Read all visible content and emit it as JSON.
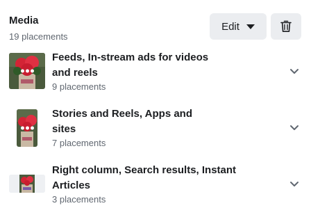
{
  "header": {
    "title": "Media",
    "subtitle": "19 placements",
    "edit_label": "Edit"
  },
  "rows": [
    {
      "title_line1": "Feeds, In-stream ads for videos",
      "title_line2": "and reels",
      "count": "9 placements",
      "thumb_shape": "square"
    },
    {
      "title_line1": "Stories and Reels, Apps and",
      "title_line2": "sites",
      "count": "7 placements",
      "thumb_shape": "vertical"
    },
    {
      "title_line1": "Right column, Search results, Instant",
      "title_line2": "Articles",
      "count": "3 placements",
      "thumb_shape": "horizontal"
    }
  ],
  "icons": {
    "edit_caret": "caret-down-icon",
    "delete": "trash-icon",
    "expand": "chevron-down-icon",
    "more": "more-dots-icon"
  },
  "colors": {
    "button_bg": "#ebedf0",
    "muted_text": "#606770",
    "primary_text": "#1c1e21"
  }
}
